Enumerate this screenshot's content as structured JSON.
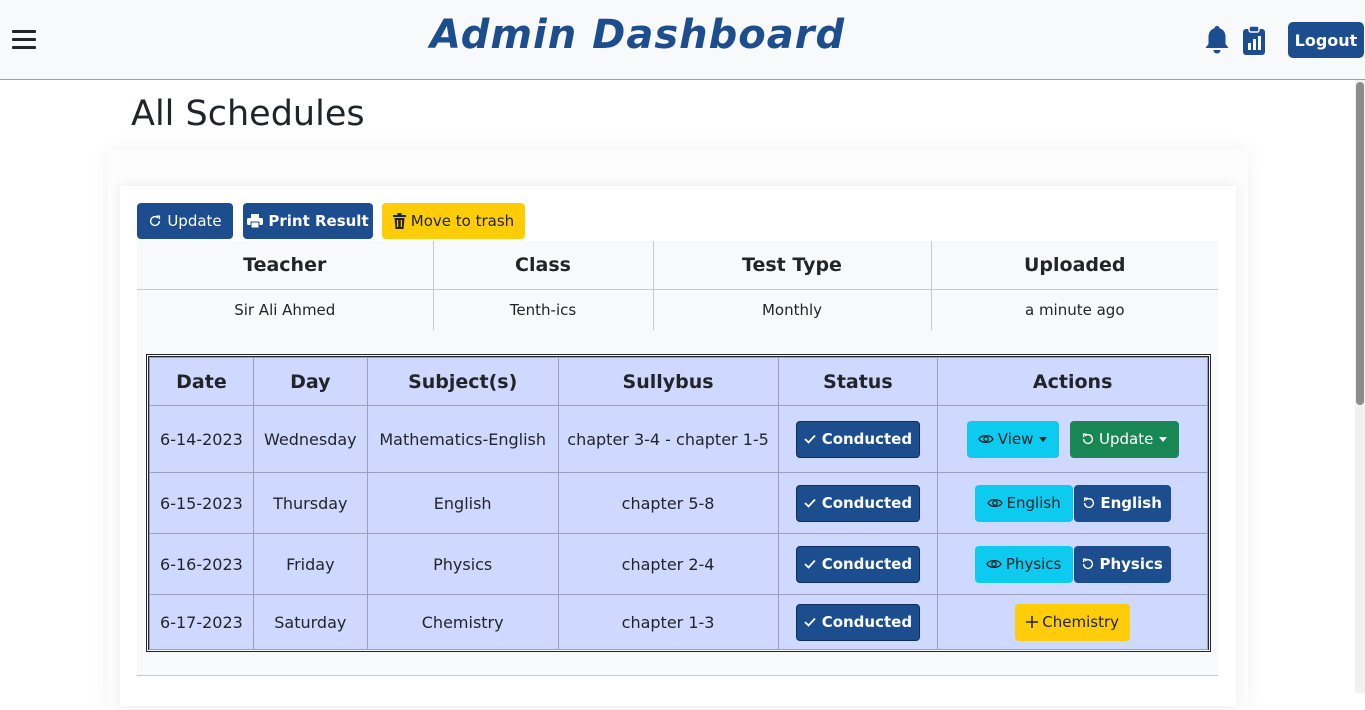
{
  "navbar": {
    "brand": "Admin Dashboard",
    "menu_icon": "hamburger-menu-icon",
    "bell_icon": "bell-icon",
    "report_icon": "clipboard-report-icon",
    "logout_label": "Logout"
  },
  "page": {
    "title": "All Schedules"
  },
  "toolbar": {
    "update_label": "Update",
    "print_label": "Print Result",
    "trash_label": "Move to trash"
  },
  "info": {
    "headers": [
      "Teacher",
      "Class",
      "Test Type",
      "Uploaded"
    ],
    "values": [
      "Sir Ali Ahmed",
      "Tenth-ics",
      "Monthly",
      "a minute ago"
    ]
  },
  "schedule": {
    "headers": [
      "Date",
      "Day",
      "Subject(s)",
      "Sullybus",
      "Status",
      "Actions"
    ],
    "rows": [
      {
        "date": "6-14-2023",
        "day": "Wednesday",
        "subject": "Mathematics-English",
        "syllabus": "chapter 3-4 - chapter 1-5",
        "status": "Conducted",
        "view_label": "View",
        "update_label": "Update"
      },
      {
        "date": "6-15-2023",
        "day": "Thursday",
        "subject": "English",
        "syllabus": "chapter 5-8",
        "status": "Conducted",
        "view_label": "English",
        "update_label": "English"
      },
      {
        "date": "6-16-2023",
        "day": "Friday",
        "subject": "Physics",
        "syllabus": "chapter 2-4",
        "status": "Conducted",
        "view_label": "Physics",
        "update_label": "Physics"
      },
      {
        "date": "6-17-2023",
        "day": "Saturday",
        "subject": "Chemistry",
        "syllabus": "chapter 1-3",
        "status": "Conducted",
        "add_label": "Chemistry"
      }
    ]
  },
  "colors": {
    "primary": "#1c4e8f",
    "warning": "#ffcc0a",
    "info": "#0dcaf0",
    "success": "#198754",
    "table_bg": "#cfd9ff"
  }
}
